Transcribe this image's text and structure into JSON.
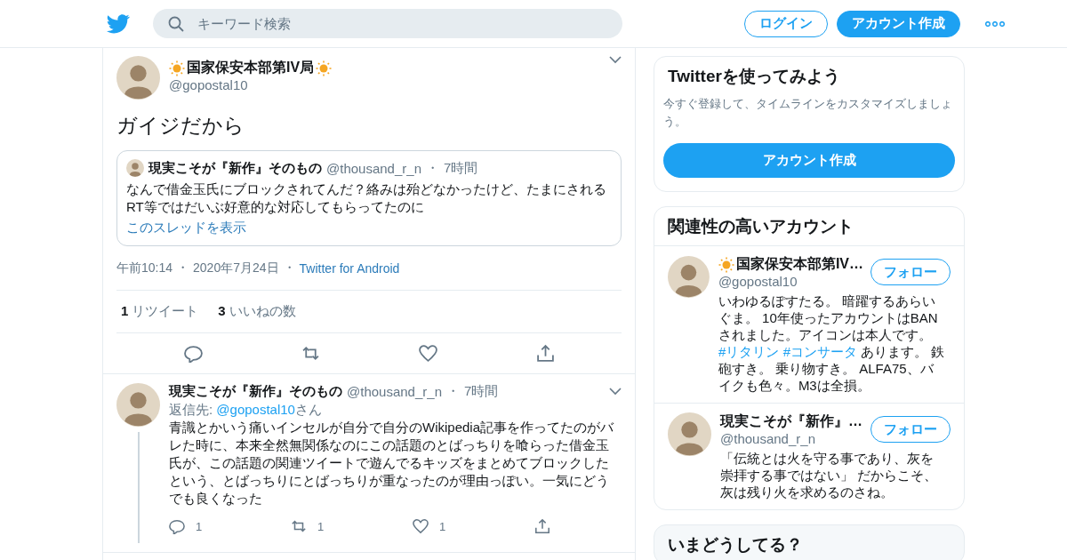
{
  "header": {
    "search": {
      "placeholder": "キーワード検索"
    },
    "buttons": [
      {
        "label": "ログイン",
        "kind": "outline"
      },
      {
        "label": "アカウント作成",
        "kind": "filled"
      }
    ]
  },
  "separator": "・",
  "tweet": {
    "author": {
      "name": "国家保安本部第IV局",
      "handle": "@gopostal10",
      "sun_left": true,
      "sun_right": true
    },
    "text": "ガイジだから",
    "quote": {
      "author": {
        "name": "現実こそが『新作』そのもの",
        "handle": "@thousand_r_n",
        "sun_left": false,
        "sun_right": false
      },
      "time": "7時間",
      "text": "なんで借金玉氏にブロックされてんだ？絡みは殆どなかったけど、たまにされるRT等ではだいぶ好意的な対応してもらってたのに",
      "link": "このスレッドを表示"
    },
    "meta": [
      "午前10:14",
      "2020年7月24日"
    ],
    "source": "Twitter for Android",
    "stats": [
      {
        "count": "1",
        "label": "リツイート"
      },
      {
        "count": "3",
        "label": "いいねの数"
      }
    ],
    "actions": [
      {
        "kind": "reply"
      },
      {
        "kind": "retweet"
      },
      {
        "kind": "like"
      },
      {
        "kind": "share"
      }
    ]
  },
  "replies": [
    {
      "author": {
        "name": "現実こそが『新作』そのもの",
        "handle": "@thousand_r_n",
        "sun_left": false,
        "sun_right": false
      },
      "time": "7時間",
      "thread_line": true,
      "reply_to": {
        "prefix": "返信先: ",
        "handle": "@gopostal10",
        "suffix": "さん"
      },
      "text": "青識とかいう痛いインセルが自分で自分のWikipedia記事を作ってたのがバレた時に、本来全然無関係なのにこの話題のとばっちりを喰らった借金玉氏が、この話題の関連ツイートで遊んでるキッズをまとめてブロックしたという、とばっちりにとばっちりが重なったのが理由っぽい。一気にどうでも良くなった",
      "actions": [
        {
          "kind": "reply",
          "count": "1"
        },
        {
          "kind": "retweet",
          "count": "1"
        },
        {
          "kind": "like",
          "count": "1"
        },
        {
          "kind": "share"
        }
      ]
    }
  ],
  "sidebar": {
    "signup": {
      "title": "Twitterを使ってみよう",
      "text": "今すぐ登録して、タイムラインをカスタマイズしましょう。",
      "button": "アカウント作成"
    },
    "related": {
      "title": "関連性の高いアカウント",
      "accounts": [
        {
          "name": "国家保安本部第IV…",
          "handle": "@gopostal10",
          "sun_left": true,
          "sun_right": false,
          "button": "フォロー",
          "bio": [
            {
              "kind": "text",
              "text": "いわゆるぽすたる。 暗躍するあらいぐま。 10年使ったアカウントはBANされました。アイコンは本人です。 "
            },
            {
              "kind": "hashtag",
              "text": "#リタリン"
            },
            {
              "kind": "hashtag",
              "text": "#コンサータ"
            },
            {
              "kind": "text",
              "text": " あります。 鉄砲すき。 乗り物すき。 ALFA75、バイクも色々。M3は全損。"
            }
          ]
        },
        {
          "name": "現実こそが『新作』…",
          "handle": "@thousand_r_n",
          "sun_left": false,
          "sun_right": false,
          "button": "フォロー",
          "bio": [
            {
              "kind": "text",
              "text": "「伝統とは火を守る事であり、灰を崇拝する事ではない」 だからこそ、灰は残り火を求めるのさね。"
            }
          ]
        }
      ]
    },
    "trends": {
      "title": "いまどうしてる？"
    }
  }
}
